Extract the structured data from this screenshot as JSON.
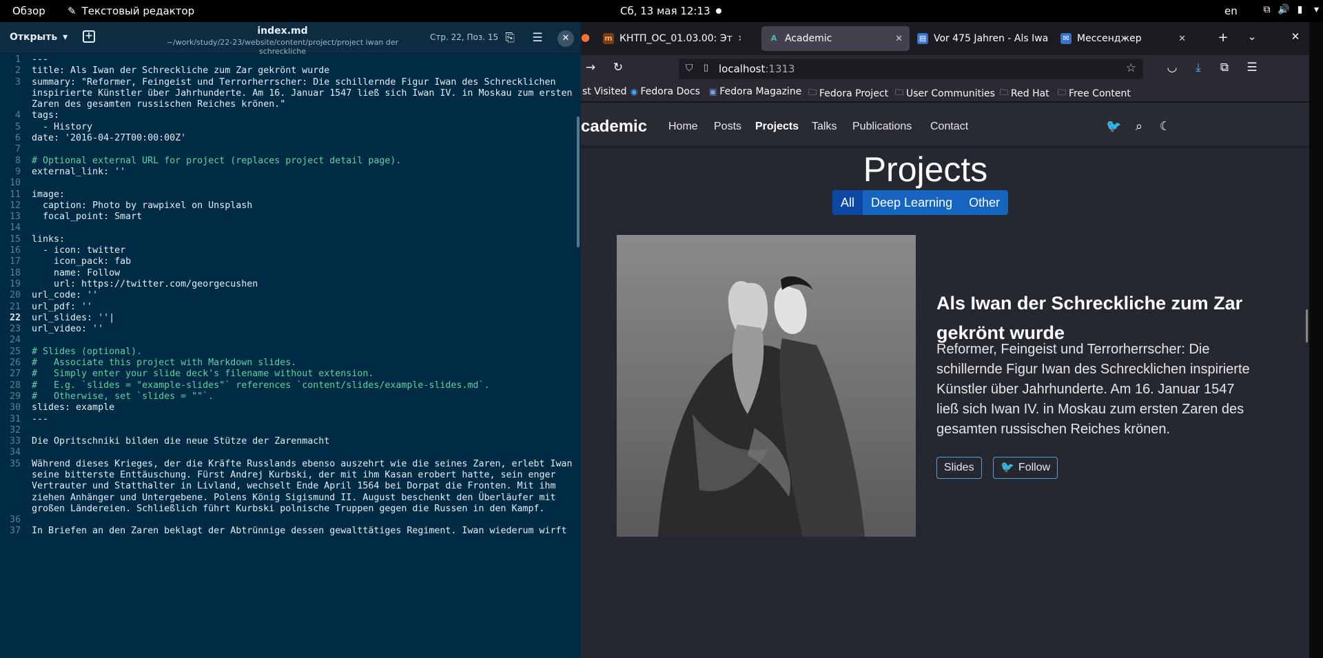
{
  "topbar": {
    "overview": "Обзор",
    "app_name": "Текстовый редактор",
    "clock": "Сб, 13 мая  12:13",
    "lang": "en"
  },
  "editor": {
    "open_label": "Открыть",
    "filename": "index.md",
    "filepath": "~/work/study/22-23/website/content/project/project iwan der schreckliche",
    "position": "Стр. 22, Поз. 15",
    "lines": [
      {
        "n": "1",
        "t": "---"
      },
      {
        "n": "2",
        "t": "title: Als Iwan der Schreckliche zum Zar gekrönt wurde"
      },
      {
        "n": "3",
        "t": "summary: \"Reformer, Feingeist und Terrorherrscher: Die schillernde Figur Iwan des Schrecklichen inspirierte Künstler über Jahrhunderte. Am 16. Januar 1547 ließ sich Iwan IV. in Moskau zum ersten Zaren des gesamten russischen Reiches krönen.\""
      },
      {
        "n": "4",
        "t": "tags:"
      },
      {
        "n": "5",
        "t": "  - History"
      },
      {
        "n": "6",
        "t": "date: '2016-04-27T00:00:00Z'"
      },
      {
        "n": "7",
        "t": ""
      },
      {
        "n": "8",
        "t": "# Optional external URL for project (replaces project detail page)."
      },
      {
        "n": "9",
        "t": "external_link: ''"
      },
      {
        "n": "10",
        "t": ""
      },
      {
        "n": "11",
        "t": "image:"
      },
      {
        "n": "12",
        "t": "  caption: Photo by rawpixel on Unsplash"
      },
      {
        "n": "13",
        "t": "  focal_point: Smart"
      },
      {
        "n": "14",
        "t": ""
      },
      {
        "n": "15",
        "t": "links:"
      },
      {
        "n": "16",
        "t": "  - icon: twitter"
      },
      {
        "n": "17",
        "t": "    icon_pack: fab"
      },
      {
        "n": "18",
        "t": "    name: Follow"
      },
      {
        "n": "19",
        "t": "    url: https://twitter.com/georgecushen"
      },
      {
        "n": "20",
        "t": "url_code: ''"
      },
      {
        "n": "21",
        "t": "url_pdf: ''"
      },
      {
        "n": "22",
        "t": "url_slides: ''|"
      },
      {
        "n": "23",
        "t": "url_video: ''"
      },
      {
        "n": "24",
        "t": ""
      },
      {
        "n": "25",
        "t": "# Slides (optional)."
      },
      {
        "n": "26",
        "t": "#   Associate this project with Markdown slides."
      },
      {
        "n": "27",
        "t": "#   Simply enter your slide deck's filename without extension."
      },
      {
        "n": "28",
        "t": "#   E.g. `slides = \"example-slides\"` references `content/slides/example-slides.md`."
      },
      {
        "n": "29",
        "t": "#   Otherwise, set `slides = \"\"`."
      },
      {
        "n": "30",
        "t": "slides: example"
      },
      {
        "n": "31",
        "t": "---"
      },
      {
        "n": "32",
        "t": ""
      },
      {
        "n": "33",
        "t": "Die Opritschniki bilden die neue Stütze der Zarenmacht"
      },
      {
        "n": "34",
        "t": ""
      },
      {
        "n": "35",
        "t": "Während dieses Krieges, der die Kräfte Russlands ebenso auszehrt wie die seines Zaren, erlebt Iwan seine bitterste Enttäuschung. Fürst Andrej Kurbski, der mit ihm Kasan erobert hatte, sein enger Vertrauter und Statthalter in Livland, wechselt Ende April 1564 bei Dorpat die Fronten. Mit ihm ziehen Anhänger und Untergebene. Polens König Sigismund II. August beschenkt den Überläufer mit großen Ländereien. Schließlich führt Kurbski polnische Truppen gegen die Russen in den Kampf."
      },
      {
        "n": "36",
        "t": ""
      },
      {
        "n": "37",
        "t": "In Briefen an den Zaren beklagt der Abtrünnige dessen gewalttätiges Regiment. Iwan wiederum wirft"
      }
    ]
  },
  "browser": {
    "tabs": [
      {
        "label": "КНТП_ОС_01.03.00: Эт",
        "fav": "m"
      },
      {
        "label": "Academic",
        "fav": "A"
      },
      {
        "label": "Vor 475 Jahren - Als Iwa",
        "fav": "▤"
      },
      {
        "label": "Мессенджер",
        "fav": "✉"
      }
    ],
    "url_host": "localhost",
    "url_port": ":1313",
    "bookmarks": [
      "st Visited",
      "Fedora Docs",
      "Fedora Magazine",
      "Fedora Project",
      "User Communities",
      "Red Hat",
      "Free Content"
    ]
  },
  "site": {
    "brand": "cademic",
    "menu": [
      "Home",
      "Posts",
      "Projects",
      "Talks",
      "Publications",
      "Contact"
    ],
    "page_title": "Projects",
    "filters": [
      "All",
      "Deep Learning",
      "Other"
    ],
    "card_title": "Als Iwan der Schreckliche zum Zar gekrönt wurde",
    "card_summary": "Reformer, Feingeist und Terrorherrscher: Die schillernde Figur Iwan des Schrecklichen inspirierte Künstler über Jahrhunderte. Am 16. Januar 1547 ließ sich Iwan IV. in Moskau zum ersten Zaren des gesamten russischen Reiches krönen.",
    "btn_slides": "Slides",
    "btn_follow": "Follow"
  }
}
